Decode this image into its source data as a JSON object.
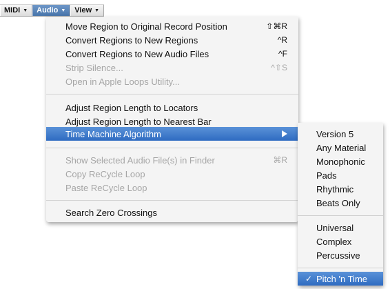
{
  "menubar": {
    "items": [
      {
        "label": "MIDI",
        "arrow": "▼"
      },
      {
        "label": "Audio",
        "arrow": "▼"
      },
      {
        "label": "View",
        "arrow": "▼"
      }
    ]
  },
  "menu": {
    "items": [
      {
        "label": "Move Region to Original Record Position",
        "shortcut": "⇧⌘R"
      },
      {
        "label": "Convert Regions to New Regions",
        "shortcut": "^R"
      },
      {
        "label": "Convert Regions to New Audio Files",
        "shortcut": "^F"
      },
      {
        "label": "Strip Silence...",
        "shortcut": "^⇧S"
      },
      {
        "label": "Open in Apple Loops Utility..."
      },
      {
        "label": "Adjust Region Length to Locators"
      },
      {
        "label": "Adjust Region Length to Nearest Bar"
      },
      {
        "label": "Time Machine Algorithm"
      },
      {
        "label": "Show Selected Audio File(s) in Finder",
        "shortcut": "⌘R"
      },
      {
        "label": "Copy ReCycle Loop"
      },
      {
        "label": "Paste ReCycle Loop"
      },
      {
        "label": "Search Zero Crossings"
      }
    ]
  },
  "submenu": {
    "items": [
      {
        "label": "Version 5"
      },
      {
        "label": "Any Material"
      },
      {
        "label": "Monophonic"
      },
      {
        "label": "Pads"
      },
      {
        "label": "Rhythmic"
      },
      {
        "label": "Beats Only"
      },
      {
        "label": "Universal"
      },
      {
        "label": "Complex"
      },
      {
        "label": "Percussive"
      },
      {
        "label": "Pitch 'n Time",
        "check": "✓"
      }
    ]
  },
  "colors": {
    "highlight": "#3b77c9",
    "disabled_text": "#a6a6a6",
    "menu_bg": "#f4f4f4"
  }
}
